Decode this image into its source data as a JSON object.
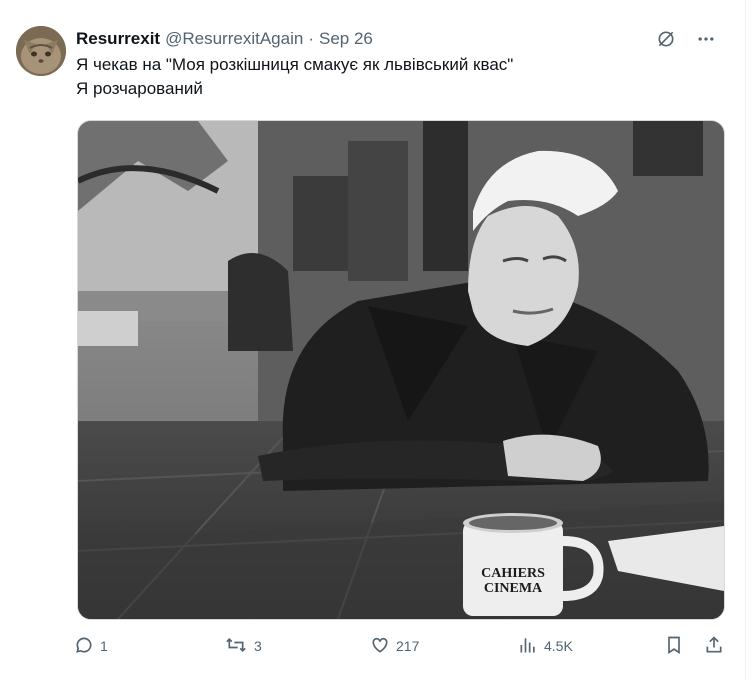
{
  "tweet": {
    "display_name": "Resurrexit",
    "handle": "@ResurrexitAgain",
    "separator": "·",
    "date": "Sep 26",
    "text_line1": "Я чекав на \"Моя розкішниця смакує як львівський квас\"",
    "text_line2": "Я розчарований"
  },
  "media": {
    "mug_line1": "CAHIERS",
    "mug_line2": "CINEMA"
  },
  "actions": {
    "replies": "1",
    "reposts": "3",
    "likes": "217",
    "views": "4.5K"
  },
  "icons": [
    "grok-icon",
    "more-icon",
    "reply-icon",
    "repost-icon",
    "like-icon",
    "views-icon",
    "bookmark-icon",
    "share-icon"
  ]
}
